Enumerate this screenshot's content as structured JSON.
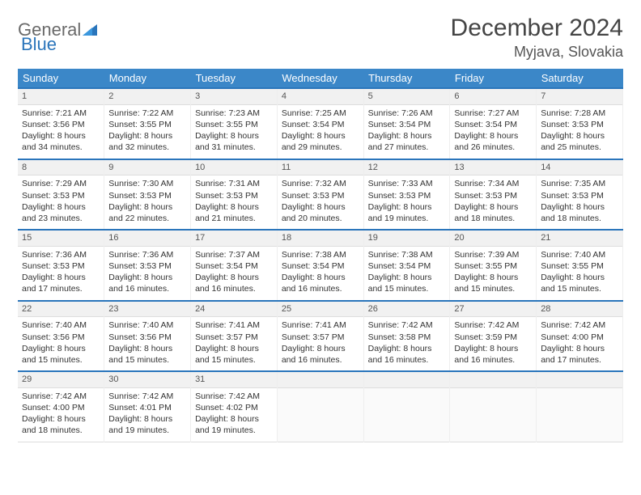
{
  "logo": {
    "word1": "General",
    "word2": "Blue"
  },
  "title": "December 2024",
  "location": "Myjava, Slovakia",
  "weekdays": [
    "Sunday",
    "Monday",
    "Tuesday",
    "Wednesday",
    "Thursday",
    "Friday",
    "Saturday"
  ],
  "weeks": [
    [
      {
        "day": "1",
        "sunrise": "Sunrise: 7:21 AM",
        "sunset": "Sunset: 3:56 PM",
        "daylight": "Daylight: 8 hours and 34 minutes."
      },
      {
        "day": "2",
        "sunrise": "Sunrise: 7:22 AM",
        "sunset": "Sunset: 3:55 PM",
        "daylight": "Daylight: 8 hours and 32 minutes."
      },
      {
        "day": "3",
        "sunrise": "Sunrise: 7:23 AM",
        "sunset": "Sunset: 3:55 PM",
        "daylight": "Daylight: 8 hours and 31 minutes."
      },
      {
        "day": "4",
        "sunrise": "Sunrise: 7:25 AM",
        "sunset": "Sunset: 3:54 PM",
        "daylight": "Daylight: 8 hours and 29 minutes."
      },
      {
        "day": "5",
        "sunrise": "Sunrise: 7:26 AM",
        "sunset": "Sunset: 3:54 PM",
        "daylight": "Daylight: 8 hours and 27 minutes."
      },
      {
        "day": "6",
        "sunrise": "Sunrise: 7:27 AM",
        "sunset": "Sunset: 3:54 PM",
        "daylight": "Daylight: 8 hours and 26 minutes."
      },
      {
        "day": "7",
        "sunrise": "Sunrise: 7:28 AM",
        "sunset": "Sunset: 3:53 PM",
        "daylight": "Daylight: 8 hours and 25 minutes."
      }
    ],
    [
      {
        "day": "8",
        "sunrise": "Sunrise: 7:29 AM",
        "sunset": "Sunset: 3:53 PM",
        "daylight": "Daylight: 8 hours and 23 minutes."
      },
      {
        "day": "9",
        "sunrise": "Sunrise: 7:30 AM",
        "sunset": "Sunset: 3:53 PM",
        "daylight": "Daylight: 8 hours and 22 minutes."
      },
      {
        "day": "10",
        "sunrise": "Sunrise: 7:31 AM",
        "sunset": "Sunset: 3:53 PM",
        "daylight": "Daylight: 8 hours and 21 minutes."
      },
      {
        "day": "11",
        "sunrise": "Sunrise: 7:32 AM",
        "sunset": "Sunset: 3:53 PM",
        "daylight": "Daylight: 8 hours and 20 minutes."
      },
      {
        "day": "12",
        "sunrise": "Sunrise: 7:33 AM",
        "sunset": "Sunset: 3:53 PM",
        "daylight": "Daylight: 8 hours and 19 minutes."
      },
      {
        "day": "13",
        "sunrise": "Sunrise: 7:34 AM",
        "sunset": "Sunset: 3:53 PM",
        "daylight": "Daylight: 8 hours and 18 minutes."
      },
      {
        "day": "14",
        "sunrise": "Sunrise: 7:35 AM",
        "sunset": "Sunset: 3:53 PM",
        "daylight": "Daylight: 8 hours and 18 minutes."
      }
    ],
    [
      {
        "day": "15",
        "sunrise": "Sunrise: 7:36 AM",
        "sunset": "Sunset: 3:53 PM",
        "daylight": "Daylight: 8 hours and 17 minutes."
      },
      {
        "day": "16",
        "sunrise": "Sunrise: 7:36 AM",
        "sunset": "Sunset: 3:53 PM",
        "daylight": "Daylight: 8 hours and 16 minutes."
      },
      {
        "day": "17",
        "sunrise": "Sunrise: 7:37 AM",
        "sunset": "Sunset: 3:54 PM",
        "daylight": "Daylight: 8 hours and 16 minutes."
      },
      {
        "day": "18",
        "sunrise": "Sunrise: 7:38 AM",
        "sunset": "Sunset: 3:54 PM",
        "daylight": "Daylight: 8 hours and 16 minutes."
      },
      {
        "day": "19",
        "sunrise": "Sunrise: 7:38 AM",
        "sunset": "Sunset: 3:54 PM",
        "daylight": "Daylight: 8 hours and 15 minutes."
      },
      {
        "day": "20",
        "sunrise": "Sunrise: 7:39 AM",
        "sunset": "Sunset: 3:55 PM",
        "daylight": "Daylight: 8 hours and 15 minutes."
      },
      {
        "day": "21",
        "sunrise": "Sunrise: 7:40 AM",
        "sunset": "Sunset: 3:55 PM",
        "daylight": "Daylight: 8 hours and 15 minutes."
      }
    ],
    [
      {
        "day": "22",
        "sunrise": "Sunrise: 7:40 AM",
        "sunset": "Sunset: 3:56 PM",
        "daylight": "Daylight: 8 hours and 15 minutes."
      },
      {
        "day": "23",
        "sunrise": "Sunrise: 7:40 AM",
        "sunset": "Sunset: 3:56 PM",
        "daylight": "Daylight: 8 hours and 15 minutes."
      },
      {
        "day": "24",
        "sunrise": "Sunrise: 7:41 AM",
        "sunset": "Sunset: 3:57 PM",
        "daylight": "Daylight: 8 hours and 15 minutes."
      },
      {
        "day": "25",
        "sunrise": "Sunrise: 7:41 AM",
        "sunset": "Sunset: 3:57 PM",
        "daylight": "Daylight: 8 hours and 16 minutes."
      },
      {
        "day": "26",
        "sunrise": "Sunrise: 7:42 AM",
        "sunset": "Sunset: 3:58 PM",
        "daylight": "Daylight: 8 hours and 16 minutes."
      },
      {
        "day": "27",
        "sunrise": "Sunrise: 7:42 AM",
        "sunset": "Sunset: 3:59 PM",
        "daylight": "Daylight: 8 hours and 16 minutes."
      },
      {
        "day": "28",
        "sunrise": "Sunrise: 7:42 AM",
        "sunset": "Sunset: 4:00 PM",
        "daylight": "Daylight: 8 hours and 17 minutes."
      }
    ],
    [
      {
        "day": "29",
        "sunrise": "Sunrise: 7:42 AM",
        "sunset": "Sunset: 4:00 PM",
        "daylight": "Daylight: 8 hours and 18 minutes."
      },
      {
        "day": "30",
        "sunrise": "Sunrise: 7:42 AM",
        "sunset": "Sunset: 4:01 PM",
        "daylight": "Daylight: 8 hours and 19 minutes."
      },
      {
        "day": "31",
        "sunrise": "Sunrise: 7:42 AM",
        "sunset": "Sunset: 4:02 PM",
        "daylight": "Daylight: 8 hours and 19 minutes."
      },
      null,
      null,
      null,
      null
    ]
  ]
}
